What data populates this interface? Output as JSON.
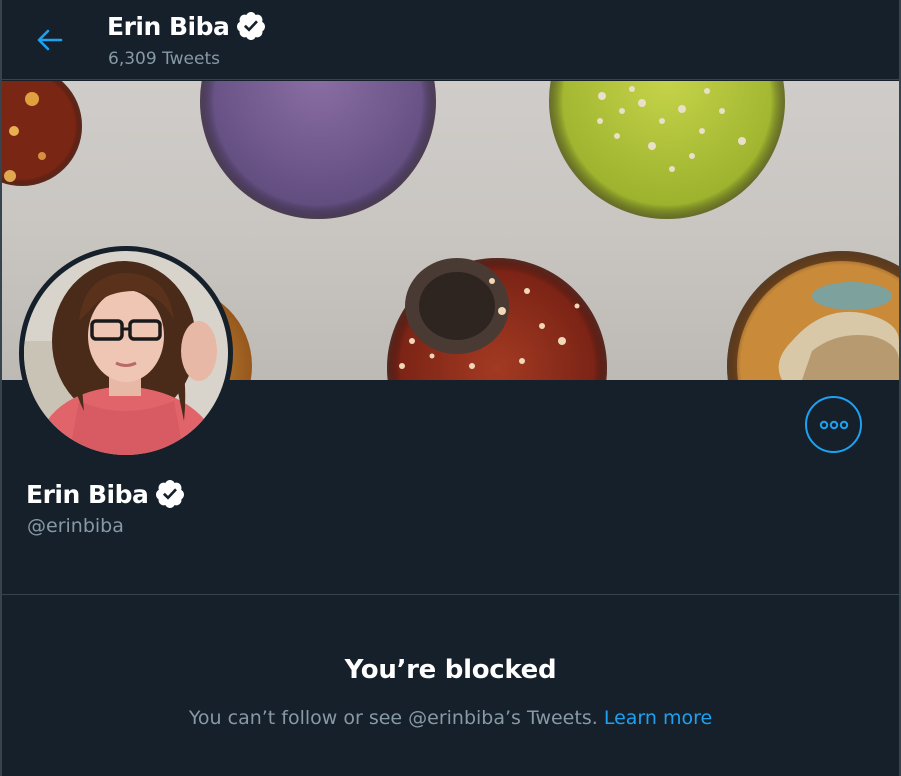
{
  "header": {
    "name": "Erin Biba",
    "tweet_count": "6,309 Tweets"
  },
  "profile": {
    "name": "Erin Biba",
    "handle": "@erinbiba",
    "verified": true
  },
  "blocked": {
    "title": "You’re blocked",
    "message": "You can’t follow or see @erinbiba’s Tweets.",
    "learn_more": "Learn more"
  },
  "icons": {
    "back": "arrow-left-icon",
    "verified": "verified-badge-icon",
    "more": "more-options-icon"
  },
  "colors": {
    "background": "#15202b",
    "accent": "#1da1f2",
    "secondary_text": "#8899a6",
    "border": "#38444d"
  }
}
